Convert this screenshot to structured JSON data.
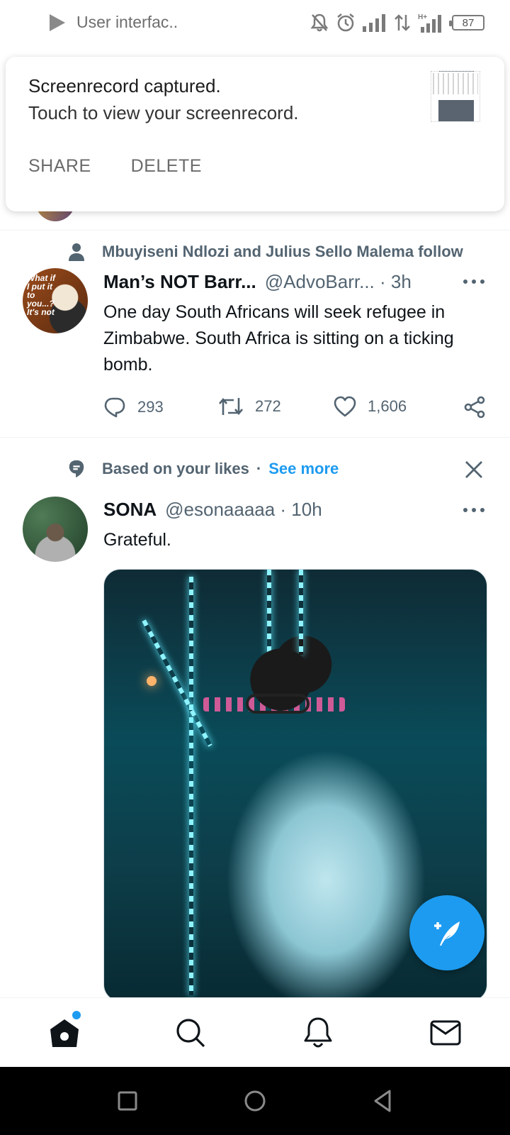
{
  "status_bar": {
    "title": "User interfac..",
    "battery": "87",
    "network": "H+"
  },
  "notification": {
    "title": "Screenrecord captured.",
    "body": "Touch to view your screenrecord.",
    "share_label": "SHARE",
    "delete_label": "DELETE"
  },
  "tweets": [
    {
      "context": "Mbuyiseni Ndlozi and Julius Sello Malema follow",
      "context_icon": "person-icon",
      "name": "Man’s NOT Barr...",
      "handle": "@AdvoBarr... · 3h",
      "text": "One day South Africans will seek refugee in Zimbabwe. South Africa is sitting on a ticking bomb.",
      "replies": "293",
      "retweets": "272",
      "likes": "1,606",
      "avatar_text": "What if I put it to you...? It's not"
    },
    {
      "context": "Based on your likes",
      "context_sep": "·",
      "see_more": "See more",
      "context_icon": "speech-bubble-icon",
      "name": "SONA",
      "handle": "@esonaaaaa · 10h",
      "text": "Grateful."
    }
  ],
  "colors": {
    "accent": "#1d9bf0",
    "text_primary": "#0f1419",
    "text_secondary": "#536471",
    "divider": "#eff3f4"
  },
  "bottom_nav": [
    "home-icon",
    "search-icon",
    "bell-icon",
    "mail-icon"
  ],
  "system_nav": [
    "recents-icon",
    "home-circle-icon",
    "back-icon"
  ]
}
